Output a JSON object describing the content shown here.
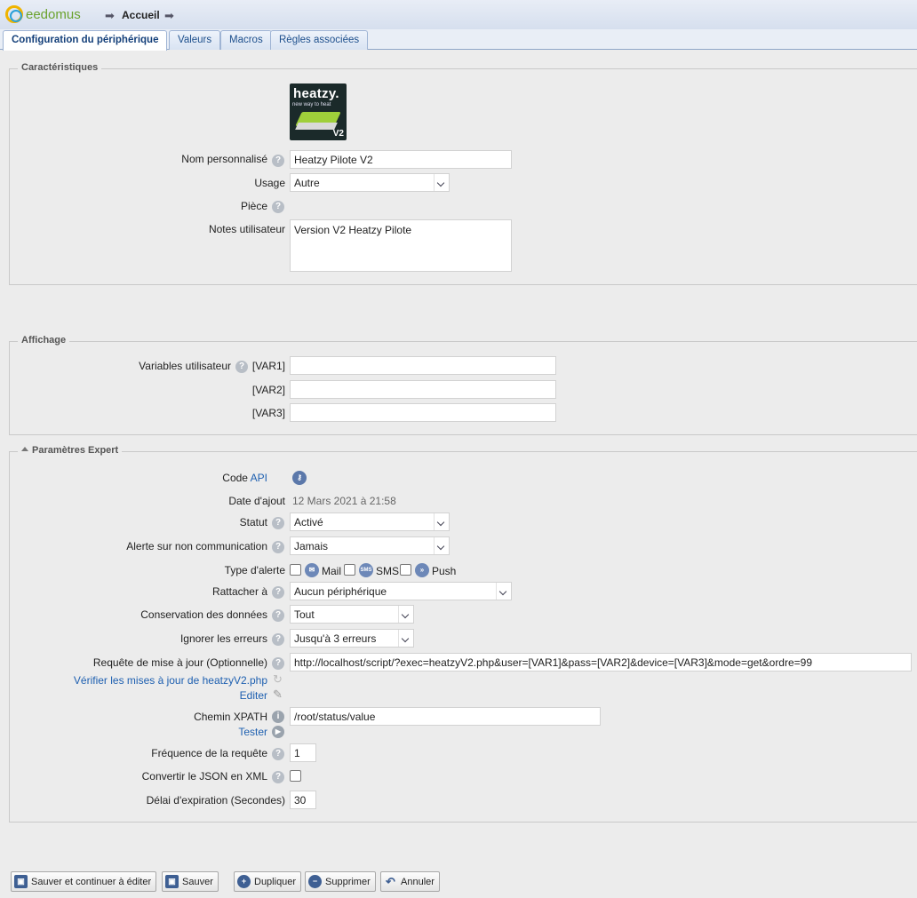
{
  "app": {
    "logo_text": "eedomus"
  },
  "breadcrumb": {
    "label": "Accueil"
  },
  "tabs": [
    {
      "label": "Configuration du périphérique",
      "active": true
    },
    {
      "label": "Valeurs"
    },
    {
      "label": "Macros"
    },
    {
      "label": "Règles associées"
    }
  ],
  "caracteristiques": {
    "legend": "Caractéristiques",
    "device_image": {
      "brand": "heatzy.",
      "tagline": "new way to heat",
      "badge": "V2"
    },
    "nom_label": "Nom personnalisé",
    "nom_value": "Heatzy Pilote V2",
    "usage_label": "Usage",
    "usage_value": "Autre",
    "piece_label": "Pièce",
    "notes_label": "Notes utilisateur",
    "notes_value": "Version V2 Heatzy Pilote"
  },
  "affichage": {
    "legend": "Affichage",
    "variables_label": "Variables utilisateur",
    "var1_label": "[VAR1]",
    "var2_label": "[VAR2]",
    "var3_label": "[VAR3]",
    "var1_value": "",
    "var2_value": "",
    "var3_value": ""
  },
  "expert": {
    "legend": "Paramètres Expert",
    "code_label": "Code",
    "code_link": "API",
    "date_label": "Date d'ajout",
    "date_value": "12 Mars 2021 à 21:58",
    "statut_label": "Statut",
    "statut_value": "Activé",
    "alerte_label": "Alerte sur non communication",
    "alerte_value": "Jamais",
    "type_alerte_label": "Type d'alerte",
    "type_alerte_mail": "Mail",
    "type_alerte_sms": "SMS",
    "type_alerte_push": "Push",
    "sms_icon_text": "SMS",
    "rattacher_label": "Rattacher à",
    "rattacher_value": "Aucun périphérique",
    "conservation_label": "Conservation des données",
    "conservation_value": "Tout",
    "ignorer_label": "Ignorer les erreurs",
    "ignorer_value": "Jusqu'à 3 erreurs",
    "requete_label": "Requête de mise à jour (Optionnelle)",
    "requete_value": "http://localhost/script/?exec=heatzyV2.php&user=[VAR1]&pass=[VAR2]&device=[VAR3]&mode=get&ordre=99",
    "verifier_link": "Vérifier les mises à jour de heatzyV2.php",
    "editer_link": "Editer",
    "xpath_label": "Chemin XPATH",
    "xpath_value": "/root/status/value",
    "tester_link": "Tester",
    "frequence_label": "Fréquence de la requête",
    "frequence_value": "1",
    "json_label": "Convertir le JSON en XML",
    "delai_label": "Délai d'expiration (Secondes)",
    "delai_value": "30"
  },
  "buttons": {
    "save_continue": "Sauver et continuer à éditer",
    "save": "Sauver",
    "duplicate": "Dupliquer",
    "delete": "Supprimer",
    "cancel": "Annuler"
  }
}
